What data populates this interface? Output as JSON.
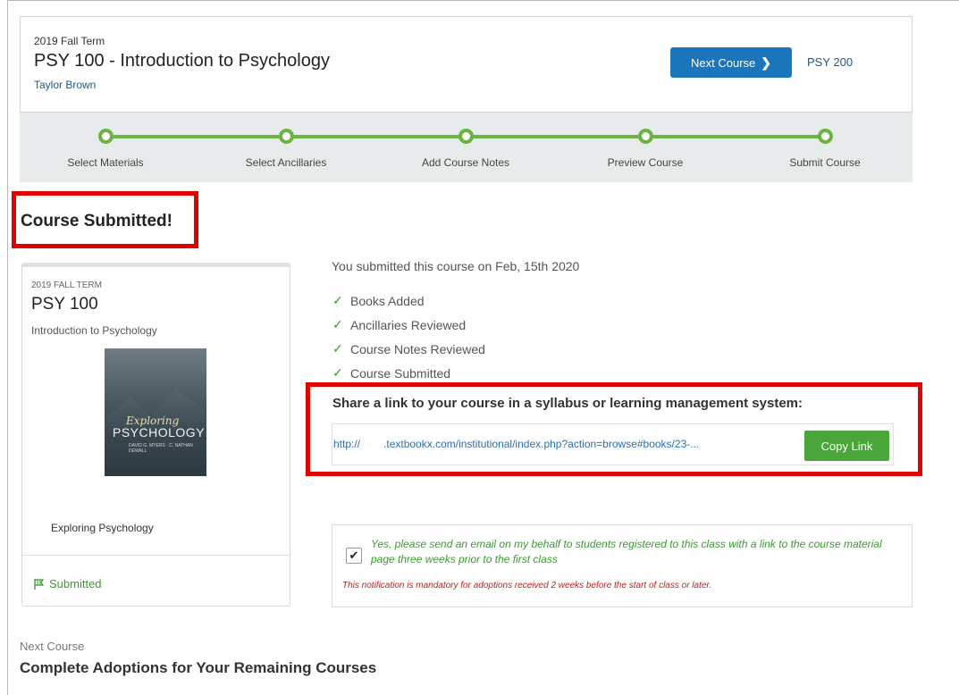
{
  "header": {
    "term": "2019 Fall Term",
    "course_title": "PSY 100 - Introduction to Psychology",
    "instructor": "Taylor Brown",
    "next_button": "Next Course",
    "next_course_code": "PSY 200"
  },
  "progress": {
    "color": "#6db33f",
    "steps": [
      {
        "label": "Select Materials",
        "completed": true
      },
      {
        "label": "Select Ancillaries",
        "completed": true
      },
      {
        "label": "Add Course Notes",
        "completed": true
      },
      {
        "label": "Preview Course",
        "completed": true
      },
      {
        "label": "Submit Course",
        "completed": true
      }
    ]
  },
  "status_heading": "Course Submitted!",
  "course_card": {
    "term": "2019 FALL TERM",
    "code": "PSY 100",
    "name": "Introduction to Psychology",
    "book_cover": {
      "word1": "Exploring",
      "word2": "PSYCHOLOGY",
      "authors": "DAVID G. MYERS · C. NATHAN DEWALL"
    },
    "book_title": "Exploring Psychology",
    "status": "Submitted",
    "status_icon": "flag-icon"
  },
  "summary": {
    "submitted_date": "You submitted this course on Feb, 15th 2020",
    "checklist": [
      "Books Added",
      "Ancillaries Reviewed",
      "Course Notes Reviewed",
      "Course Submitted"
    ],
    "check_glyph": "✓"
  },
  "share": {
    "label": "Share a link to your course in a syllabus or learning management system:",
    "link_prefix": "http://",
    "link_rest": ".textbookx.com/institutional/index.php?action=browse#books/23-...",
    "copy_button": "Copy Link"
  },
  "notification": {
    "checked": true,
    "text": "Yes, please send an email on my behalf to students registered to this class with a link to the course material page three weeks prior to the first class",
    "warning": "This notification is mandatory for adoptions received 2 weeks before the start of class or later."
  },
  "next_section": {
    "small_label": "Next Course",
    "heading": "Complete Adoptions for Your Remaining Courses"
  },
  "colors": {
    "primary": "#1a75bb",
    "success": "#4aa63a",
    "highlight": "#e50000",
    "warning": "#c0201f"
  }
}
